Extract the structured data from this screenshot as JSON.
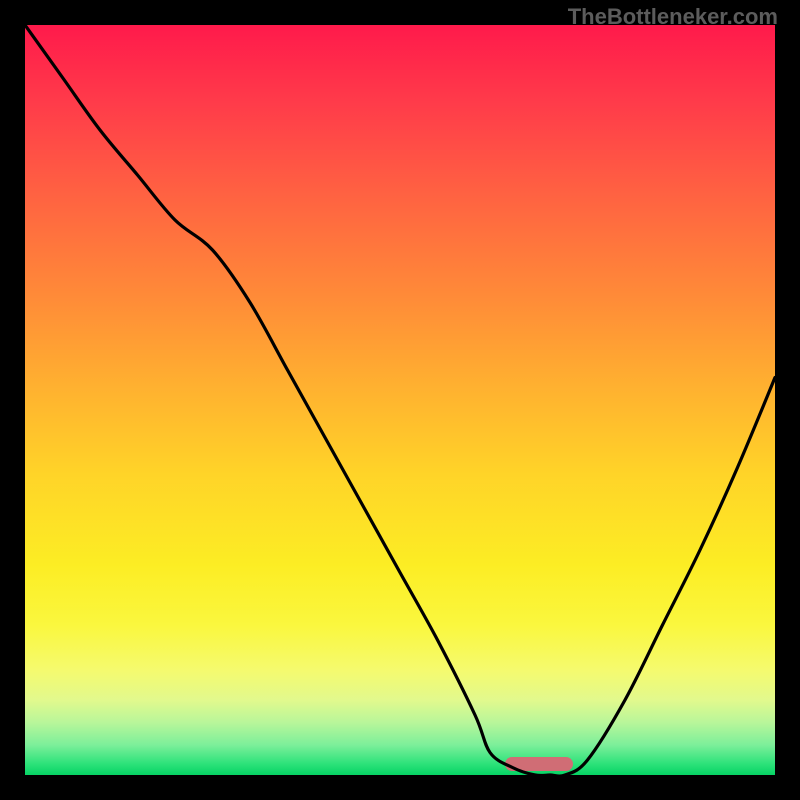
{
  "watermark": "TheBottleneker.com",
  "chart_data": {
    "type": "line",
    "title": "",
    "xlabel": "",
    "ylabel": "",
    "xlim": [
      0,
      100
    ],
    "ylim": [
      0,
      100
    ],
    "x": [
      0,
      5,
      10,
      15,
      20,
      25,
      30,
      35,
      40,
      45,
      50,
      55,
      60,
      62,
      65,
      68,
      70,
      72,
      75,
      80,
      85,
      90,
      95,
      100
    ],
    "y": [
      100,
      93,
      86,
      80,
      74,
      70,
      63,
      54,
      45,
      36,
      27,
      18,
      8,
      3,
      1,
      0,
      0,
      0,
      2,
      10,
      20,
      30,
      41,
      53
    ],
    "marker": {
      "x_start": 64,
      "x_end": 73,
      "y": 1.5
    },
    "background_gradient": {
      "top": "#ff1a4b",
      "mid": "#ffd428",
      "bottom": "#06d364"
    }
  }
}
